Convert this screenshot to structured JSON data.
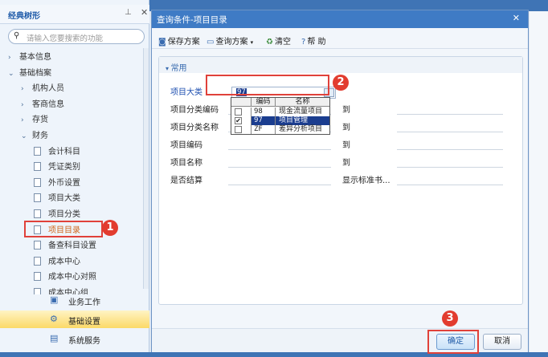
{
  "left_panel": {
    "title": "经典树形",
    "search_placeholder": "请输入您要搜索的功能",
    "tree": [
      {
        "label": "基本信息",
        "level": 0,
        "arrow": "›"
      },
      {
        "label": "基础档案",
        "level": 0,
        "arrow": "⌄"
      },
      {
        "label": "机构人员",
        "level": 1,
        "arrow": "›"
      },
      {
        "label": "客商信息",
        "level": 1,
        "arrow": "›"
      },
      {
        "label": "存货",
        "level": 1,
        "arrow": "›"
      },
      {
        "label": "财务",
        "level": 1,
        "arrow": "⌄"
      },
      {
        "label": "会计科目",
        "level": 2
      },
      {
        "label": "凭证类别",
        "level": 2
      },
      {
        "label": "外币设置",
        "level": 2
      },
      {
        "label": "项目大类",
        "level": 2
      },
      {
        "label": "项目分类",
        "level": 2
      },
      {
        "label": "项目目录",
        "level": 2,
        "selected": true
      },
      {
        "label": "备查科目设置",
        "level": 2
      },
      {
        "label": "成本中心",
        "level": 2
      },
      {
        "label": "成本中心对照",
        "level": 2
      },
      {
        "label": "成本中心组",
        "level": 2
      }
    ],
    "nav": [
      {
        "label": "业务工作",
        "icon": "workflow-icon"
      },
      {
        "label": "基础设置",
        "icon": "gear-icon",
        "active": true
      },
      {
        "label": "系统服务",
        "icon": "server-icon"
      }
    ]
  },
  "dialog": {
    "title": "查询条件-项目目录",
    "toolbar": {
      "save": "保存方案",
      "query": "查询方案",
      "clear": "清空",
      "help": "帮 助"
    },
    "group_title": "常用",
    "rows": [
      {
        "label": "项目大类",
        "value": "97",
        "to": ""
      },
      {
        "label": "项目分类编码",
        "to": "到"
      },
      {
        "label": "项目分类名称",
        "to": "到"
      },
      {
        "label": "项目编码",
        "to": "到"
      },
      {
        "label": "项目名称",
        "to": "到"
      },
      {
        "label": "是否结算",
        "to": "显示标准书..."
      }
    ],
    "dropdown": {
      "headers": [
        "编码",
        "名称"
      ],
      "rows": [
        {
          "code": "98",
          "name": "现金流量项目",
          "checked": false
        },
        {
          "code": "97",
          "name": "项目管理",
          "checked": true
        },
        {
          "code": "ZF",
          "name": "差异分析项目",
          "checked": false
        }
      ]
    },
    "ok": "确定",
    "cancel": "取消"
  },
  "annotations": [
    "1",
    "2",
    "3"
  ],
  "colors": {
    "accent": "#3f7bc5",
    "annotation": "#e23c2f",
    "selection": "#1b3d8f"
  }
}
